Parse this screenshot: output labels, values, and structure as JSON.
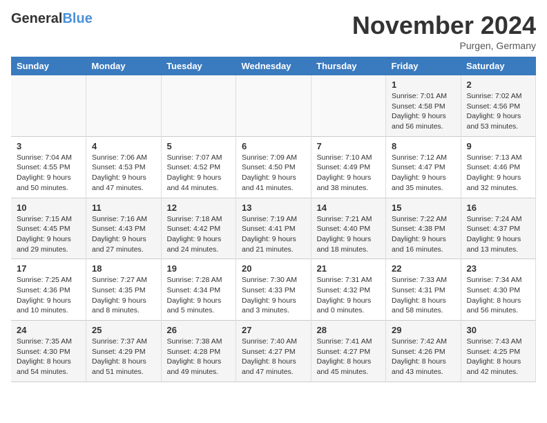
{
  "header": {
    "logo_general": "General",
    "logo_blue": "Blue",
    "title": "November 2024",
    "location": "Purgen, Germany"
  },
  "weekdays": [
    "Sunday",
    "Monday",
    "Tuesday",
    "Wednesday",
    "Thursday",
    "Friday",
    "Saturday"
  ],
  "weeks": [
    [
      {
        "day": "",
        "info": ""
      },
      {
        "day": "",
        "info": ""
      },
      {
        "day": "",
        "info": ""
      },
      {
        "day": "",
        "info": ""
      },
      {
        "day": "",
        "info": ""
      },
      {
        "day": "1",
        "info": "Sunrise: 7:01 AM\nSunset: 4:58 PM\nDaylight: 9 hours\nand 56 minutes."
      },
      {
        "day": "2",
        "info": "Sunrise: 7:02 AM\nSunset: 4:56 PM\nDaylight: 9 hours\nand 53 minutes."
      }
    ],
    [
      {
        "day": "3",
        "info": "Sunrise: 7:04 AM\nSunset: 4:55 PM\nDaylight: 9 hours\nand 50 minutes."
      },
      {
        "day": "4",
        "info": "Sunrise: 7:06 AM\nSunset: 4:53 PM\nDaylight: 9 hours\nand 47 minutes."
      },
      {
        "day": "5",
        "info": "Sunrise: 7:07 AM\nSunset: 4:52 PM\nDaylight: 9 hours\nand 44 minutes."
      },
      {
        "day": "6",
        "info": "Sunrise: 7:09 AM\nSunset: 4:50 PM\nDaylight: 9 hours\nand 41 minutes."
      },
      {
        "day": "7",
        "info": "Sunrise: 7:10 AM\nSunset: 4:49 PM\nDaylight: 9 hours\nand 38 minutes."
      },
      {
        "day": "8",
        "info": "Sunrise: 7:12 AM\nSunset: 4:47 PM\nDaylight: 9 hours\nand 35 minutes."
      },
      {
        "day": "9",
        "info": "Sunrise: 7:13 AM\nSunset: 4:46 PM\nDaylight: 9 hours\nand 32 minutes."
      }
    ],
    [
      {
        "day": "10",
        "info": "Sunrise: 7:15 AM\nSunset: 4:45 PM\nDaylight: 9 hours\nand 29 minutes."
      },
      {
        "day": "11",
        "info": "Sunrise: 7:16 AM\nSunset: 4:43 PM\nDaylight: 9 hours\nand 27 minutes."
      },
      {
        "day": "12",
        "info": "Sunrise: 7:18 AM\nSunset: 4:42 PM\nDaylight: 9 hours\nand 24 minutes."
      },
      {
        "day": "13",
        "info": "Sunrise: 7:19 AM\nSunset: 4:41 PM\nDaylight: 9 hours\nand 21 minutes."
      },
      {
        "day": "14",
        "info": "Sunrise: 7:21 AM\nSunset: 4:40 PM\nDaylight: 9 hours\nand 18 minutes."
      },
      {
        "day": "15",
        "info": "Sunrise: 7:22 AM\nSunset: 4:38 PM\nDaylight: 9 hours\nand 16 minutes."
      },
      {
        "day": "16",
        "info": "Sunrise: 7:24 AM\nSunset: 4:37 PM\nDaylight: 9 hours\nand 13 minutes."
      }
    ],
    [
      {
        "day": "17",
        "info": "Sunrise: 7:25 AM\nSunset: 4:36 PM\nDaylight: 9 hours\nand 10 minutes."
      },
      {
        "day": "18",
        "info": "Sunrise: 7:27 AM\nSunset: 4:35 PM\nDaylight: 9 hours\nand 8 minutes."
      },
      {
        "day": "19",
        "info": "Sunrise: 7:28 AM\nSunset: 4:34 PM\nDaylight: 9 hours\nand 5 minutes."
      },
      {
        "day": "20",
        "info": "Sunrise: 7:30 AM\nSunset: 4:33 PM\nDaylight: 9 hours\nand 3 minutes."
      },
      {
        "day": "21",
        "info": "Sunrise: 7:31 AM\nSunset: 4:32 PM\nDaylight: 9 hours\nand 0 minutes."
      },
      {
        "day": "22",
        "info": "Sunrise: 7:33 AM\nSunset: 4:31 PM\nDaylight: 8 hours\nand 58 minutes."
      },
      {
        "day": "23",
        "info": "Sunrise: 7:34 AM\nSunset: 4:30 PM\nDaylight: 8 hours\nand 56 minutes."
      }
    ],
    [
      {
        "day": "24",
        "info": "Sunrise: 7:35 AM\nSunset: 4:30 PM\nDaylight: 8 hours\nand 54 minutes."
      },
      {
        "day": "25",
        "info": "Sunrise: 7:37 AM\nSunset: 4:29 PM\nDaylight: 8 hours\nand 51 minutes."
      },
      {
        "day": "26",
        "info": "Sunrise: 7:38 AM\nSunset: 4:28 PM\nDaylight: 8 hours\nand 49 minutes."
      },
      {
        "day": "27",
        "info": "Sunrise: 7:40 AM\nSunset: 4:27 PM\nDaylight: 8 hours\nand 47 minutes."
      },
      {
        "day": "28",
        "info": "Sunrise: 7:41 AM\nSunset: 4:27 PM\nDaylight: 8 hours\nand 45 minutes."
      },
      {
        "day": "29",
        "info": "Sunrise: 7:42 AM\nSunset: 4:26 PM\nDaylight: 8 hours\nand 43 minutes."
      },
      {
        "day": "30",
        "info": "Sunrise: 7:43 AM\nSunset: 4:25 PM\nDaylight: 8 hours\nand 42 minutes."
      }
    ]
  ]
}
